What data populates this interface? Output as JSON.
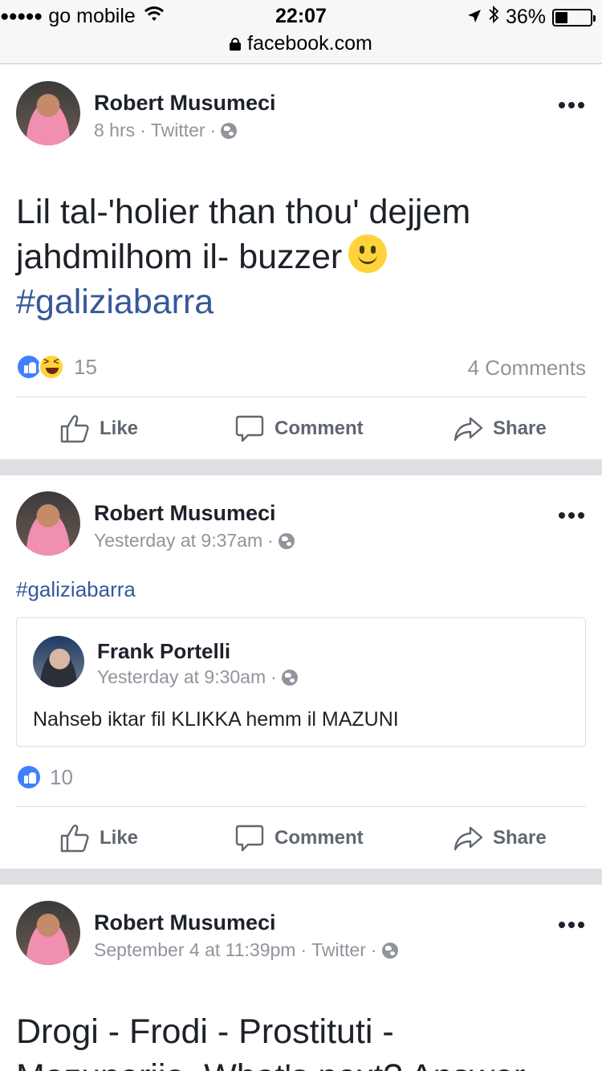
{
  "status_bar": {
    "carrier": "go mobile",
    "time": "22:07",
    "battery_percent": "36%",
    "battery_level": 0.36,
    "url": "facebook.com"
  },
  "actions": {
    "like": "Like",
    "comment": "Comment",
    "share": "Share"
  },
  "posts": [
    {
      "author": "Robert Musumeci",
      "time": "8 hrs",
      "source": "Twitter",
      "text_line1": "Lil tal-'holier than thou' dejjem",
      "text_line2": "jahdmilhom il- buzzer",
      "hashtag": "#galiziabarra",
      "reaction_count": "15",
      "comments": "4 Comments"
    },
    {
      "author": "Robert Musumeci",
      "time": "Yesterday at 9:37am",
      "hashtag": "#galiziabarra",
      "shared": {
        "author": "Frank Portelli",
        "time": "Yesterday at 9:30am",
        "text": "Nahseb iktar fil KLIKKA hemm il MAZUNI"
      },
      "reaction_count": "10"
    },
    {
      "author": "Robert Musumeci",
      "time": "September 4 at 11:39pm",
      "source": "Twitter",
      "text_line1": "Drogi - Frodi - Prostituti -",
      "text_line2": "Mazunerija. What's next? Answer"
    }
  ],
  "separators": {
    "dot": "·"
  }
}
